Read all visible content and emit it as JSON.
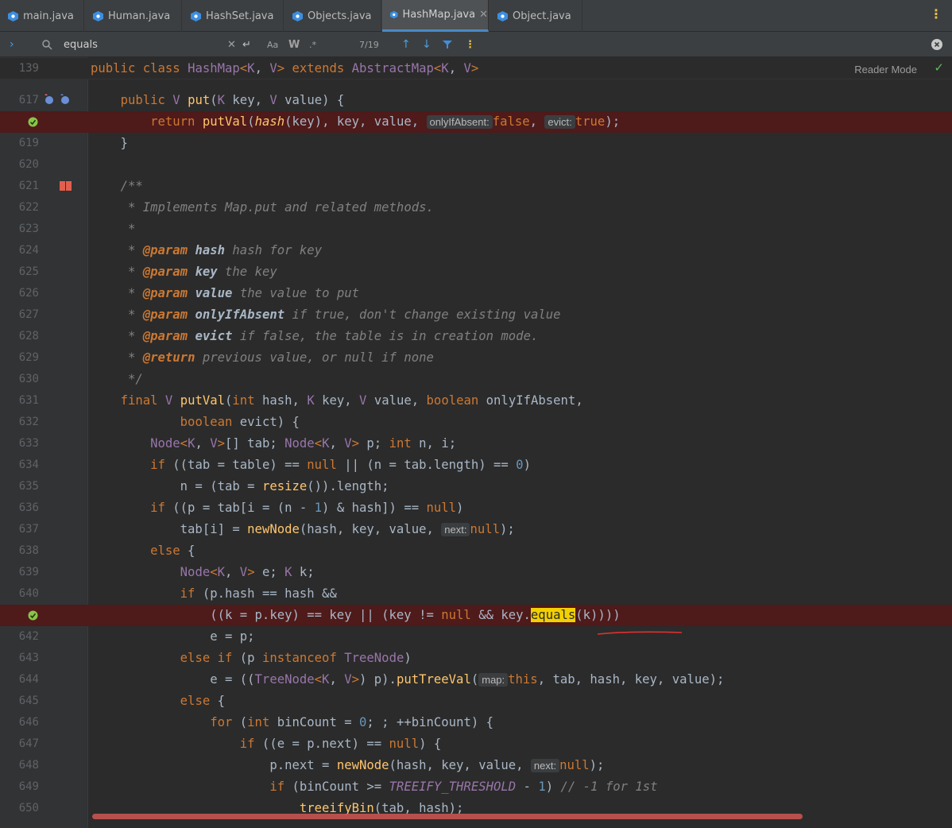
{
  "tabs": [
    {
      "label": "main.java",
      "active": false
    },
    {
      "label": "Human.java",
      "active": false
    },
    {
      "label": "HashSet.java",
      "active": false
    },
    {
      "label": "Objects.java",
      "active": false
    },
    {
      "label": "HashMap.java",
      "active": true
    },
    {
      "label": "Object.java",
      "active": false
    }
  ],
  "search": {
    "query": "equals",
    "match_count": "7/19",
    "case_label": "Aa",
    "word_label": "W",
    "regex_label": ".*"
  },
  "editor": {
    "reader_mode": "Reader Mode",
    "header_line_number": "139",
    "line_numbers": [
      "617",
      "",
      "619",
      "620",
      "621",
      "622",
      "623",
      "624",
      "625",
      "626",
      "627",
      "628",
      "629",
      "630",
      "631",
      "632",
      "633",
      "634",
      "635",
      "636",
      "637",
      "638",
      "639",
      "640",
      "",
      "642",
      "643",
      "644",
      "645",
      "646",
      "647",
      "648",
      "649",
      "650"
    ],
    "hints": {
      "onlyIfAbsent": "onlyIfAbsent:",
      "evict": "evict:",
      "next": "next:",
      "map": "map:"
    }
  },
  "colors": {
    "keyword": "#cc7832",
    "type": "#9876aa",
    "function": "#ffc66d",
    "number": "#6897bb",
    "comment": "#808080",
    "breakpoint_line": "#4f1a1a",
    "search_match": "#f3d000"
  },
  "icons": {
    "tab_file": "java-class-icon",
    "breakpoint_ok": "check-circle-icon",
    "override": "override-icon",
    "doc": "book-icon"
  }
}
